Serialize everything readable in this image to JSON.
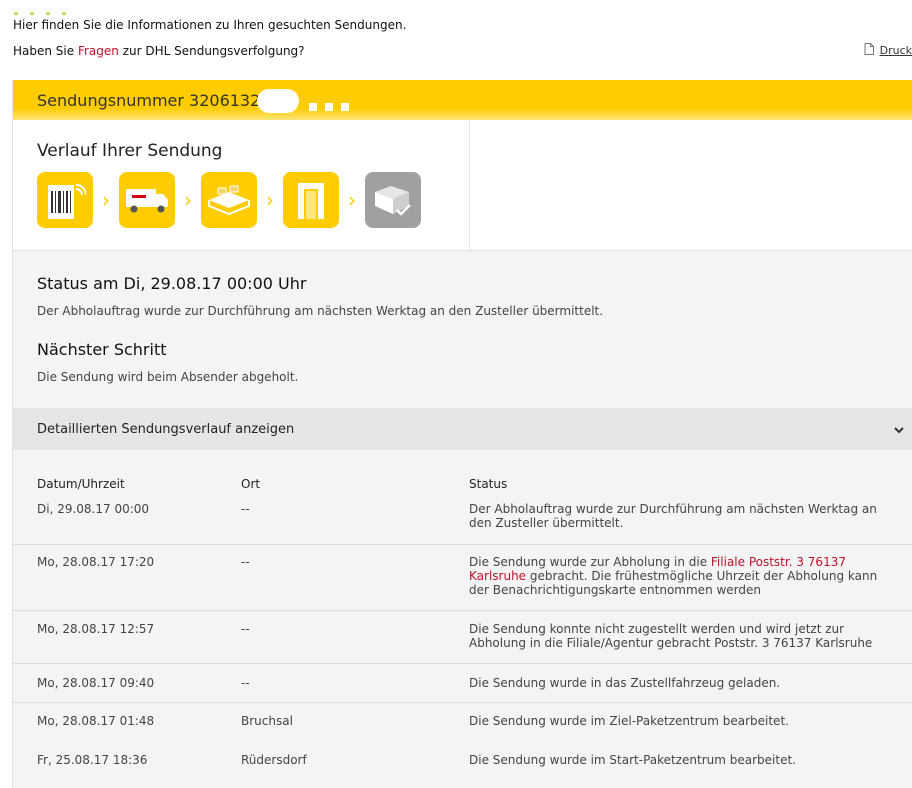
{
  "intro": {
    "line1": "Hier finden Sie die Informationen zu Ihren gesuchten Sendungen.",
    "line2_pre": "Haben Sie ",
    "line2_link": "Fragen",
    "line2_post": " zur DHL Sendungsverfolgung?",
    "print_label": "Druck"
  },
  "shipment": {
    "number_label": "Sendungsnummer 32061323"
  },
  "history": {
    "title": "Verlauf Ihrer Sendung",
    "steps": [
      {
        "icon": "barcode-icon",
        "state": "active"
      },
      {
        "icon": "delivery-van-icon",
        "state": "active"
      },
      {
        "icon": "parcel-center-icon",
        "state": "active"
      },
      {
        "icon": "pickup-station-icon",
        "state": "active"
      },
      {
        "icon": "delivered-package-icon",
        "state": "inactive"
      }
    ]
  },
  "status": {
    "title": "Status am Di, 29.08.17 00:00 Uhr",
    "text": "Der Abholauftrag wurde zur Durchführung am nächsten Werktag an den Zusteller übermittelt.",
    "next_title": "Nächster Schritt",
    "next_text": "Die Sendung wird beim Absender abgeholt."
  },
  "details": {
    "toggle_label": "Detaillierten Sendungsverlauf anzeigen",
    "columns": [
      "Datum/Uhrzeit",
      "Ort",
      "Status"
    ],
    "rows": [
      {
        "date": "Di, 29.08.17 00:00",
        "place": "--",
        "status": "Der Abholauftrag wurde zur Durchführung am nächsten Werktag an den Zusteller übermittelt."
      },
      {
        "date": "Mo, 28.08.17 17:20",
        "place": "--",
        "status_pre": "Die Sendung wurde zur Abholung in die ",
        "status_link": "Filiale Poststr. 3 76137 Karlsruhe",
        "status_post": " gebracht. Die frühestmögliche Uhrzeit der Abholung kann der Benachrichtigungskarte entnommen werden"
      },
      {
        "date": "Mo, 28.08.17 12:57",
        "place": "--",
        "status": "Die Sendung konnte nicht zugestellt werden und wird jetzt zur Abholung in die Filiale/Agentur gebracht Poststr. 3 76137 Karlsruhe"
      },
      {
        "date": "Mo, 28.08.17 09:40",
        "place": "--",
        "status": "Die Sendung wurde in das Zustellfahrzeug geladen."
      },
      {
        "date": "Mo, 28.08.17 01:48",
        "place": "Bruchsal",
        "status": "Die Sendung wurde im Ziel-Paketzentrum bearbeitet."
      },
      {
        "date": "Fr, 25.08.17 18:36",
        "place": "Rüdersdorf",
        "status": "Die Sendung wurde im Start-Paketzentrum bearbeitet."
      }
    ]
  },
  "colors": {
    "dhl_yellow": "#ffcc00",
    "dhl_red": "#c0112b",
    "inactive_gray": "#a0a0a0"
  }
}
